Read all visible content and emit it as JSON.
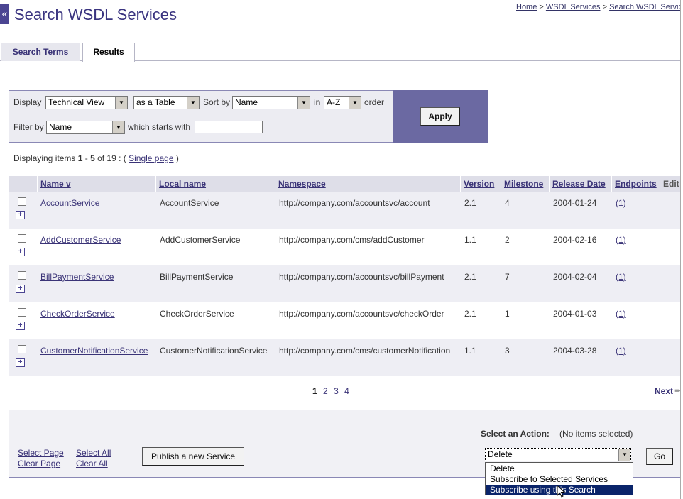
{
  "header": {
    "collapse_label": "«",
    "title": "Search WSDL Services",
    "breadcrumb": [
      "Home",
      "WSDL Services",
      "Search WSDL Service"
    ],
    "breadcrumb_sep": ">"
  },
  "tabs": [
    {
      "label": "Search Terms",
      "active": false
    },
    {
      "label": "Results",
      "active": true
    }
  ],
  "filters": {
    "display_label": "Display",
    "view_value": "Technical View",
    "format_value": "as a Table",
    "sort_label": "Sort by",
    "sort_value": "Name",
    "in_label": "in",
    "order_value": "A-Z",
    "order_label": "order",
    "filter_label": "Filter by",
    "filter_value": "Name",
    "starts_label": "which starts with",
    "starts_value": "",
    "apply_label": "Apply"
  },
  "summary": {
    "prefix": "Displaying items ",
    "from": "1",
    "dash": " - ",
    "to": "5",
    "of_text": " of 19 : ( ",
    "single_page_link": "Single page",
    "suffix": " )"
  },
  "table": {
    "columns": [
      "Name v",
      "Local name",
      "Namespace",
      "Version",
      "Milestone",
      "Release Date",
      "Endpoints",
      "Edit"
    ],
    "rows": [
      {
        "name": "AccountService",
        "local": "AccountService",
        "namespace": "http://company.com/accountsvc/account",
        "version": "2.1",
        "milestone": "4",
        "date": "2004-01-24",
        "endpoints": "(1)"
      },
      {
        "name": "AddCustomerService",
        "local": "AddCustomerService",
        "namespace": "http://company.com/cms/addCustomer",
        "version": "1.1",
        "milestone": "2",
        "date": "2004-02-16",
        "endpoints": "(1)"
      },
      {
        "name": "BillPaymentService",
        "local": "BillPaymentService",
        "namespace": "http://company.com/accountsvc/billPayment",
        "version": "2.1",
        "milestone": "7",
        "date": "2004-02-04",
        "endpoints": "(1)"
      },
      {
        "name": "CheckOrderService",
        "local": "CheckOrderService",
        "namespace": "http://company.com/accountsvc/checkOrder",
        "version": "2.1",
        "milestone": "1",
        "date": "2004-01-03",
        "endpoints": "(1)"
      },
      {
        "name": "CustomerNotificationService",
        "local": "CustomerNotificationService",
        "namespace": "http://company.com/cms/customerNotification",
        "version": "1.1",
        "milestone": "3",
        "date": "2004-03-28",
        "endpoints": "(1)"
      }
    ]
  },
  "pagination": {
    "pages": [
      "1",
      "2",
      "3",
      "4"
    ],
    "current": "1",
    "next_label": "Next"
  },
  "actions": {
    "select_page": "Select Page",
    "clear_page": "Clear Page",
    "select_all": "Select All",
    "clear_all": "Clear All",
    "publish_label": "Publish a new Service",
    "action_label": "Select an Action:",
    "no_items": "(No items selected)",
    "action_value": "Delete",
    "go_label": "Go",
    "options": [
      "Delete",
      "Subscribe to Selected Services",
      "Subscribe using this Search"
    ],
    "highlighted_option": "Subscribe using this Search"
  },
  "colors": {
    "accent": "#4b4592",
    "apply_panel": "#6b69a2",
    "selected_option": "#0a246a"
  }
}
